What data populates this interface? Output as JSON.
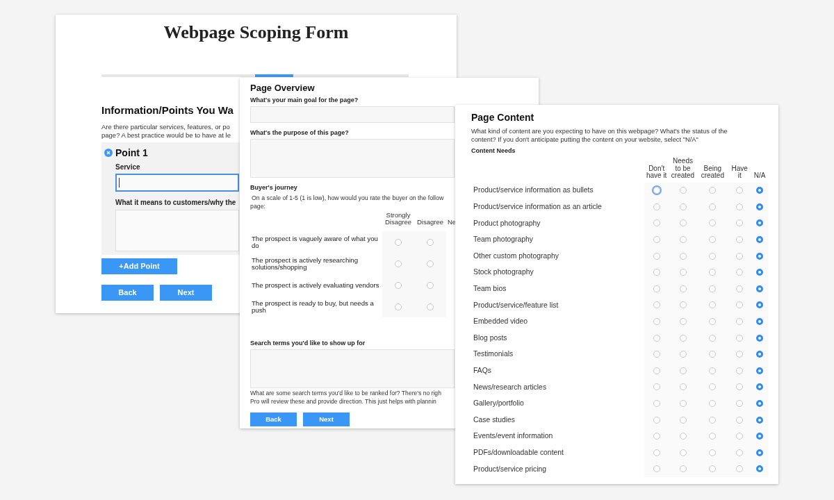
{
  "scoping_form": {
    "title": "Webpage Scoping Form",
    "progress_steps": [
      {
        "selected": false
      },
      {
        "selected": false
      },
      {
        "selected": false
      },
      {
        "selected": false
      },
      {
        "selected": true
      },
      {
        "selected": false
      },
      {
        "selected": false
      },
      {
        "selected": false
      }
    ],
    "section_heading": "Information/Points You Wa",
    "intro_lines": [
      "Are there particular services, features, or po",
      "page? A best practice would be to have at le"
    ],
    "point": {
      "title": "Point 1",
      "service_label": "Service",
      "service_focused": true,
      "meaning_label": "What it means to customers/why the"
    },
    "add_button": "+Add Point",
    "buttons": [
      "Back",
      "Next"
    ]
  },
  "page_overview": {
    "title": "Page Overview",
    "goal_label": "What's your main goal for the page?",
    "purpose_label": "What's the purpose of this page?",
    "journey_label": "Buyer's journey",
    "journey_lines": [
      "On a scale of 1-5 (1 is low), how would you rate the buyer on the follow",
      "page:"
    ],
    "columns": [
      "Strongly Disagree",
      "Disagree",
      "Ne"
    ],
    "rows": [
      {
        "label": "The prospect is vaguely aware of what you do",
        "options": [
          {
            "selected": false
          },
          {
            "selected": false
          }
        ]
      },
      {
        "label": "The prospect is actively researching solutions/shopping",
        "options": [
          {
            "selected": false
          },
          {
            "selected": false
          }
        ]
      },
      {
        "label": "The prospect is actively evaluating vendors",
        "options": [
          {
            "selected": false
          },
          {
            "selected": false
          }
        ]
      },
      {
        "label": "The prospect is ready to buy, but needs a push",
        "options": [
          {
            "selected": false
          },
          {
            "selected": false
          }
        ]
      }
    ],
    "search_label": "Search terms you'd like to show up for",
    "search_help_lines": [
      "What are some search terms you'd like to be ranked for? There's no righ",
      "Pro will review these and provide direction. This just helps with plannin"
    ],
    "buttons": [
      "Back",
      "Next"
    ]
  },
  "page_content": {
    "title": "Page Content",
    "description": "What kind of content are you expecting to have on this webpage? What's the status of the content? If you don't anticipate putting the content on your website, select \"N/A\"",
    "section_label": "Content Needs",
    "columns": [
      "Don't have it",
      "Needs to be created",
      "Being created",
      "Have it",
      "N/A"
    ],
    "rows": [
      {
        "label": "Product/service information as bullets",
        "options": [
          {
            "selected": false,
            "focused": true
          },
          {
            "selected": false,
            "focused": false
          },
          {
            "selected": false,
            "focused": false
          },
          {
            "selected": false,
            "focused": false
          },
          {
            "selected": true,
            "focused": false
          }
        ]
      },
      {
        "label": "Product/service information as an article",
        "options": [
          {
            "selected": false,
            "focused": false
          },
          {
            "selected": false,
            "focused": false
          },
          {
            "selected": false,
            "focused": false
          },
          {
            "selected": false,
            "focused": false
          },
          {
            "selected": true,
            "focused": false
          }
        ]
      },
      {
        "label": "Product photography",
        "options": [
          {
            "selected": false,
            "focused": false
          },
          {
            "selected": false,
            "focused": false
          },
          {
            "selected": false,
            "focused": false
          },
          {
            "selected": false,
            "focused": false
          },
          {
            "selected": true,
            "focused": false
          }
        ]
      },
      {
        "label": "Team photography",
        "options": [
          {
            "selected": false,
            "focused": false
          },
          {
            "selected": false,
            "focused": false
          },
          {
            "selected": false,
            "focused": false
          },
          {
            "selected": false,
            "focused": false
          },
          {
            "selected": true,
            "focused": false
          }
        ]
      },
      {
        "label": "Other custom photography",
        "options": [
          {
            "selected": false,
            "focused": false
          },
          {
            "selected": false,
            "focused": false
          },
          {
            "selected": false,
            "focused": false
          },
          {
            "selected": false,
            "focused": false
          },
          {
            "selected": true,
            "focused": false
          }
        ]
      },
      {
        "label": "Stock photography",
        "options": [
          {
            "selected": false,
            "focused": false
          },
          {
            "selected": false,
            "focused": false
          },
          {
            "selected": false,
            "focused": false
          },
          {
            "selected": false,
            "focused": false
          },
          {
            "selected": true,
            "focused": false
          }
        ]
      },
      {
        "label": "Team bios",
        "options": [
          {
            "selected": false,
            "focused": false
          },
          {
            "selected": false,
            "focused": false
          },
          {
            "selected": false,
            "focused": false
          },
          {
            "selected": false,
            "focused": false
          },
          {
            "selected": true,
            "focused": false
          }
        ]
      },
      {
        "label": "Product/service/feature list",
        "options": [
          {
            "selected": false,
            "focused": false
          },
          {
            "selected": false,
            "focused": false
          },
          {
            "selected": false,
            "focused": false
          },
          {
            "selected": false,
            "focused": false
          },
          {
            "selected": true,
            "focused": false
          }
        ]
      },
      {
        "label": "Embedded video",
        "options": [
          {
            "selected": false,
            "focused": false
          },
          {
            "selected": false,
            "focused": false
          },
          {
            "selected": false,
            "focused": false
          },
          {
            "selected": false,
            "focused": false
          },
          {
            "selected": true,
            "focused": false
          }
        ]
      },
      {
        "label": "Blog posts",
        "options": [
          {
            "selected": false,
            "focused": false
          },
          {
            "selected": false,
            "focused": false
          },
          {
            "selected": false,
            "focused": false
          },
          {
            "selected": false,
            "focused": false
          },
          {
            "selected": true,
            "focused": false
          }
        ]
      },
      {
        "label": "Testimonials",
        "options": [
          {
            "selected": false,
            "focused": false
          },
          {
            "selected": false,
            "focused": false
          },
          {
            "selected": false,
            "focused": false
          },
          {
            "selected": false,
            "focused": false
          },
          {
            "selected": true,
            "focused": false
          }
        ]
      },
      {
        "label": "FAQs",
        "options": [
          {
            "selected": false,
            "focused": false
          },
          {
            "selected": false,
            "focused": false
          },
          {
            "selected": false,
            "focused": false
          },
          {
            "selected": false,
            "focused": false
          },
          {
            "selected": true,
            "focused": false
          }
        ]
      },
      {
        "label": "News/research articles",
        "options": [
          {
            "selected": false,
            "focused": false
          },
          {
            "selected": false,
            "focused": false
          },
          {
            "selected": false,
            "focused": false
          },
          {
            "selected": false,
            "focused": false
          },
          {
            "selected": true,
            "focused": false
          }
        ]
      },
      {
        "label": "Gallery/portfolio",
        "options": [
          {
            "selected": false,
            "focused": false
          },
          {
            "selected": false,
            "focused": false
          },
          {
            "selected": false,
            "focused": false
          },
          {
            "selected": false,
            "focused": false
          },
          {
            "selected": true,
            "focused": false
          }
        ]
      },
      {
        "label": "Case studies",
        "options": [
          {
            "selected": false,
            "focused": false
          },
          {
            "selected": false,
            "focused": false
          },
          {
            "selected": false,
            "focused": false
          },
          {
            "selected": false,
            "focused": false
          },
          {
            "selected": true,
            "focused": false
          }
        ]
      },
      {
        "label": "Events/event information",
        "options": [
          {
            "selected": false,
            "focused": false
          },
          {
            "selected": false,
            "focused": false
          },
          {
            "selected": false,
            "focused": false
          },
          {
            "selected": false,
            "focused": false
          },
          {
            "selected": true,
            "focused": false
          }
        ]
      },
      {
        "label": "PDFs/downloadable content",
        "options": [
          {
            "selected": false,
            "focused": false
          },
          {
            "selected": false,
            "focused": false
          },
          {
            "selected": false,
            "focused": false
          },
          {
            "selected": false,
            "focused": false
          },
          {
            "selected": true,
            "focused": false
          }
        ]
      },
      {
        "label": "Product/service pricing",
        "options": [
          {
            "selected": false,
            "focused": false
          },
          {
            "selected": false,
            "focused": false
          },
          {
            "selected": false,
            "focused": false
          },
          {
            "selected": false,
            "focused": false
          },
          {
            "selected": true,
            "focused": false
          }
        ]
      }
    ]
  }
}
